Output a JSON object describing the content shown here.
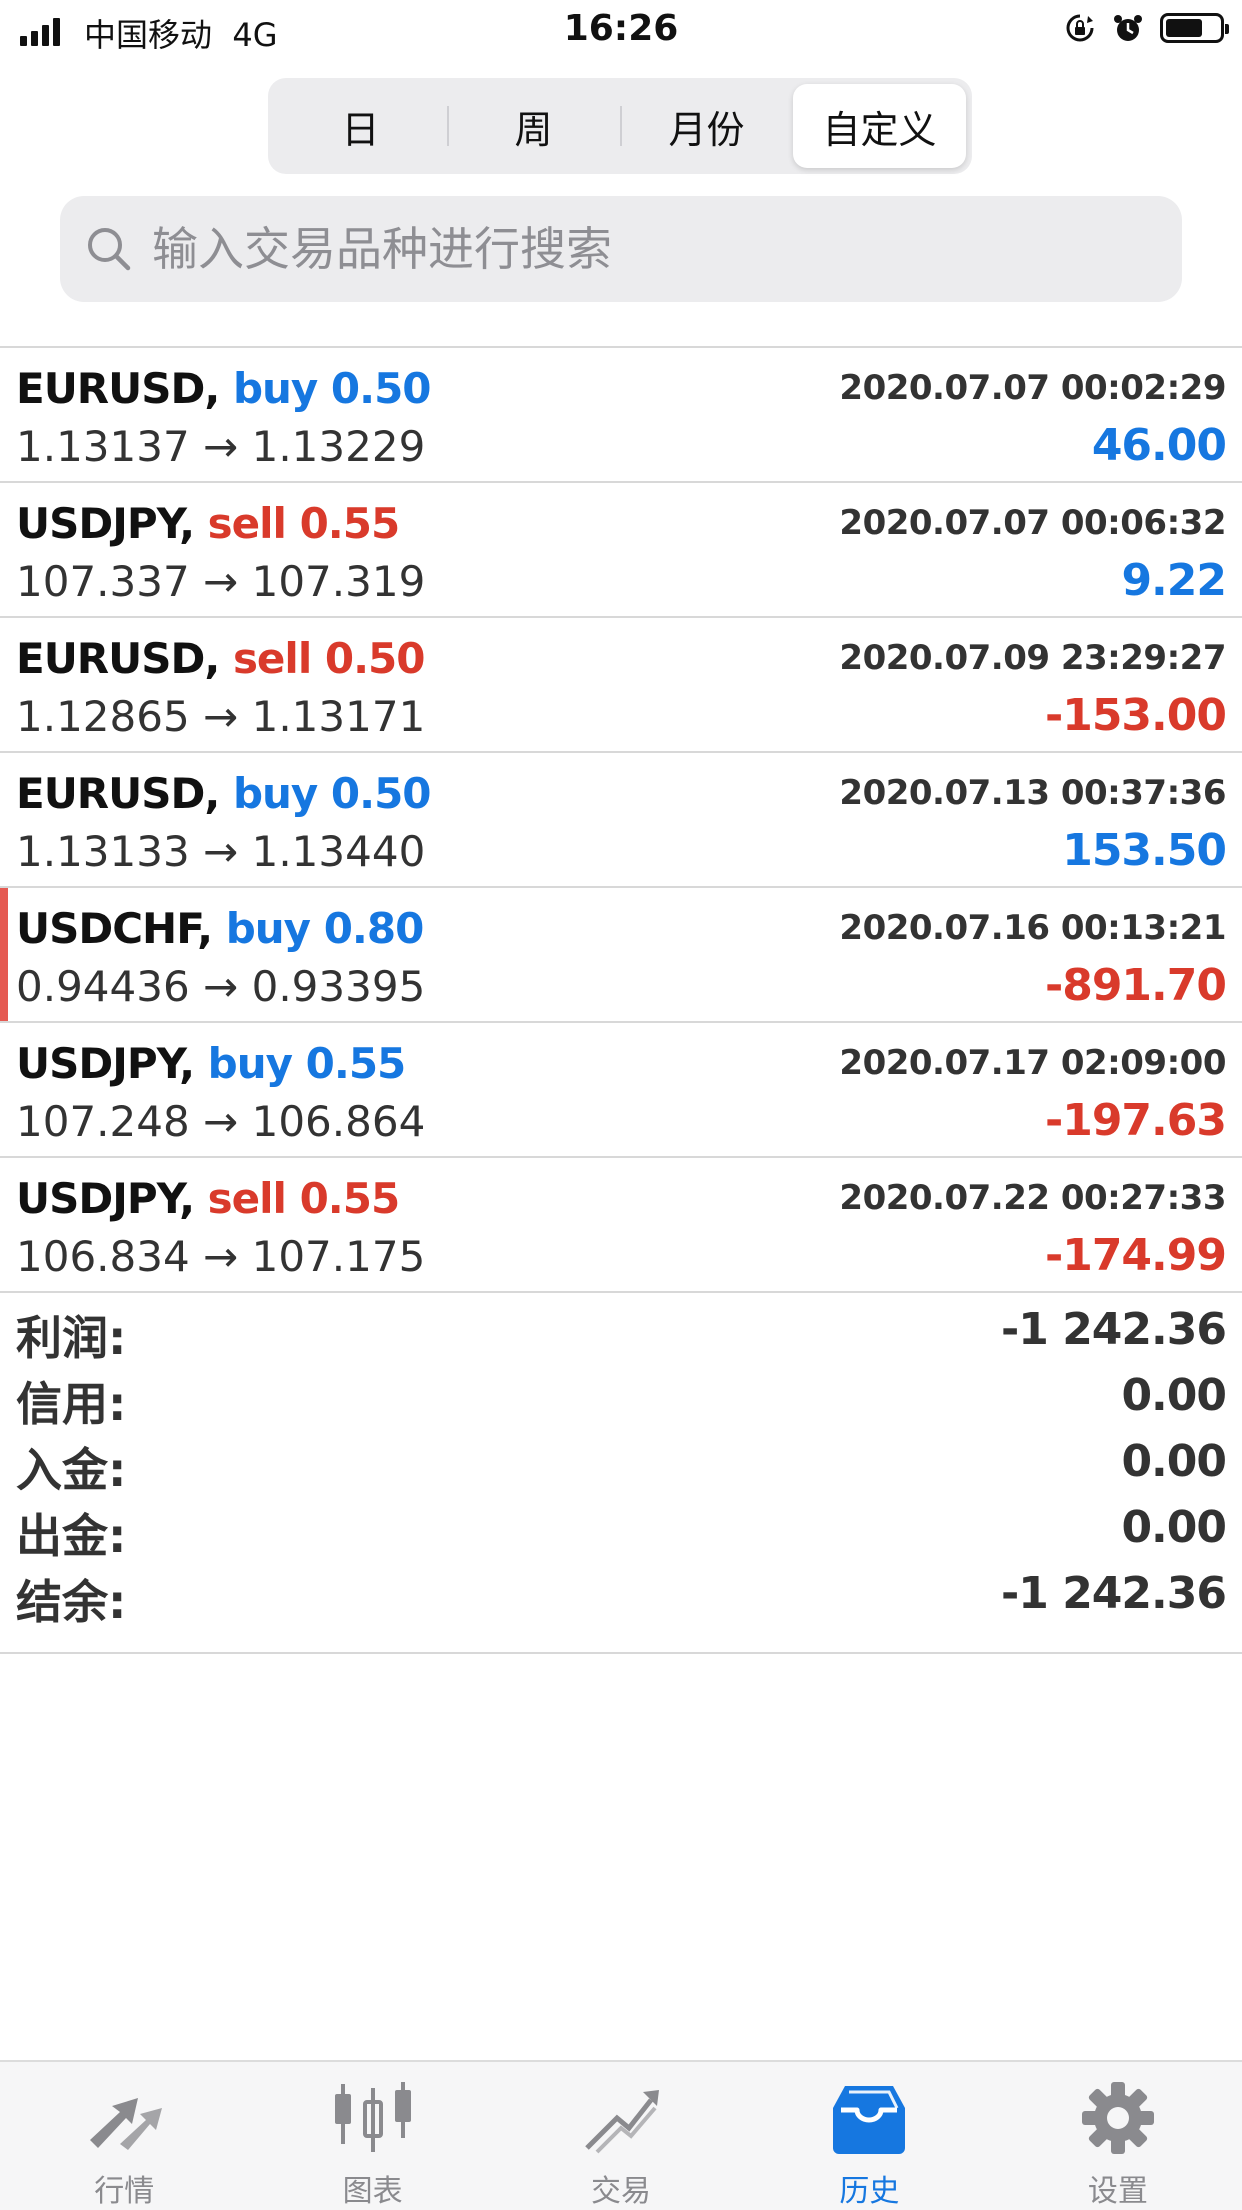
{
  "status_bar": {
    "carrier": "中国移动",
    "network": "4G",
    "time": "16:26",
    "battery_level": 0.7
  },
  "period_tabs": {
    "items": [
      {
        "label": "日",
        "active": false
      },
      {
        "label": "周",
        "active": false
      },
      {
        "label": "月份",
        "active": false
      },
      {
        "label": "自定义",
        "active": true
      }
    ]
  },
  "search": {
    "placeholder": "输入交易品种进行搜索",
    "value": ""
  },
  "trades": [
    {
      "symbol": "EURUSD,",
      "side": "buy",
      "volume": "0.50",
      "time": "2020.07.07 00:02:29",
      "open": "1.13137",
      "close": "1.13229",
      "arrow": "→",
      "profit": "46.00"
    },
    {
      "symbol": "USDJPY,",
      "side": "sell",
      "volume": "0.55",
      "time": "2020.07.07 00:06:32",
      "open": "107.337",
      "close": "107.319",
      "arrow": "→",
      "profit": "9.22"
    },
    {
      "symbol": "EURUSD,",
      "side": "sell",
      "volume": "0.50",
      "time": "2020.07.09 23:29:27",
      "open": "1.12865",
      "close": "1.13171",
      "arrow": "→",
      "profit": "-153.00"
    },
    {
      "symbol": "EURUSD,",
      "side": "buy",
      "volume": "0.50",
      "time": "2020.07.13 00:37:36",
      "open": "1.13133",
      "close": "1.13440",
      "arrow": "→",
      "profit": "153.50"
    },
    {
      "symbol": "USDCHF,",
      "side": "buy",
      "volume": "0.80",
      "time": "2020.07.16 00:13:21",
      "open": "0.94436",
      "close": "0.93395",
      "arrow": "→",
      "profit": "-891.70"
    },
    {
      "symbol": "USDJPY,",
      "side": "buy",
      "volume": "0.55",
      "time": "2020.07.17 02:09:00",
      "open": "107.248",
      "close": "106.864",
      "arrow": "→",
      "profit": "-197.63"
    },
    {
      "symbol": "USDJPY,",
      "side": "sell",
      "volume": "0.55",
      "time": "2020.07.22 00:27:33",
      "open": "106.834",
      "close": "107.175",
      "arrow": "→",
      "profit": "-174.99"
    }
  ],
  "summary": [
    {
      "label": "利润:",
      "value": "-1 242.36"
    },
    {
      "label": "信用:",
      "value": "0.00"
    },
    {
      "label": "入金:",
      "value": "0.00"
    },
    {
      "label": "出金:",
      "value": "0.00"
    },
    {
      "label": "结余:",
      "value": "-1 242.36"
    }
  ],
  "tab_bar": {
    "items": [
      {
        "label": "行情",
        "icon": "quotes-arrows-icon",
        "active": false
      },
      {
        "label": "图表",
        "icon": "candlestick-chart-icon",
        "active": false
      },
      {
        "label": "交易",
        "icon": "trade-trend-icon",
        "active": false
      },
      {
        "label": "历史",
        "icon": "history-inbox-icon",
        "active": true
      },
      {
        "label": "设置",
        "icon": "gear-icon",
        "active": false
      }
    ]
  },
  "colors": {
    "accent_blue": "#1677e0",
    "loss_red": "#d93a2b",
    "selection_marker": "#e55a52"
  }
}
